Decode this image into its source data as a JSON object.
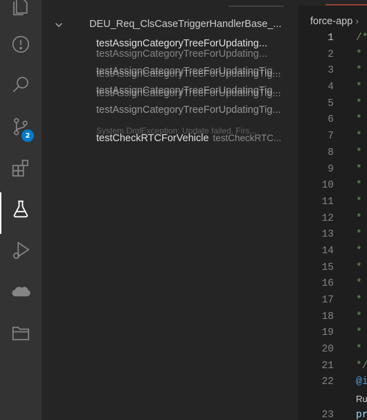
{
  "activity_bar": {
    "items": [
      {
        "name": "explorer-icon"
      },
      {
        "name": "problems-icon"
      },
      {
        "name": "search-icon"
      },
      {
        "name": "source-control-icon",
        "badge": "2"
      },
      {
        "name": "extensions-icon"
      },
      {
        "name": "testing-icon",
        "active": true
      },
      {
        "name": "run-debug-icon"
      },
      {
        "name": "salesforce-icon"
      },
      {
        "name": "org-browser-icon"
      }
    ],
    "accent_color": "#007acc"
  },
  "test_tree": {
    "suite": {
      "label": "DEU_Req_ClsCaseTriggerHandlerBase_..."
    },
    "tests": [
      {
        "label": "testAssignCategoryTreeForUpdating...",
        "ghost": "testAssignCategoryTreeForUpdating..."
      },
      {
        "label": "testAssignCategoryTreeForUpdatingTig...",
        "ghost": "testAssignCategoryTreeForUpdatingTig..."
      },
      {
        "label": "testAssignCategoryTreeForUpdatingTig...",
        "ghost": "testAssignCategoryTreeForUpdatingTig..."
      },
      {
        "label": "testAssignCategoryTreeForUpdatingTig...",
        "ghost": "System.DmlException: Update failed. Firs..."
      },
      {
        "label": "testCheckRTCForVehicle",
        "desc": "testCheckRTC..."
      }
    ]
  },
  "editor": {
    "breadcrumb": "force-app",
    "breadcrumb_sep": "›",
    "line_numbers": [
      "1",
      "2",
      "3",
      "4",
      "5",
      "6",
      "7",
      "8",
      "9",
      "10",
      "11",
      "12",
      "13",
      "14",
      "15",
      "16",
      "17",
      "18",
      "19",
      "20",
      "21",
      "22",
      "",
      "23"
    ],
    "code_lines": [
      "/*",
      "*",
      "*",
      "*",
      "*",
      "*",
      "*",
      "*",
      "*",
      "*",
      "*",
      "*",
      "*",
      "*",
      "*",
      "*",
      "*",
      "*",
      "*",
      "*",
      "*/",
      "@i",
      "Ru",
      "pr"
    ]
  }
}
